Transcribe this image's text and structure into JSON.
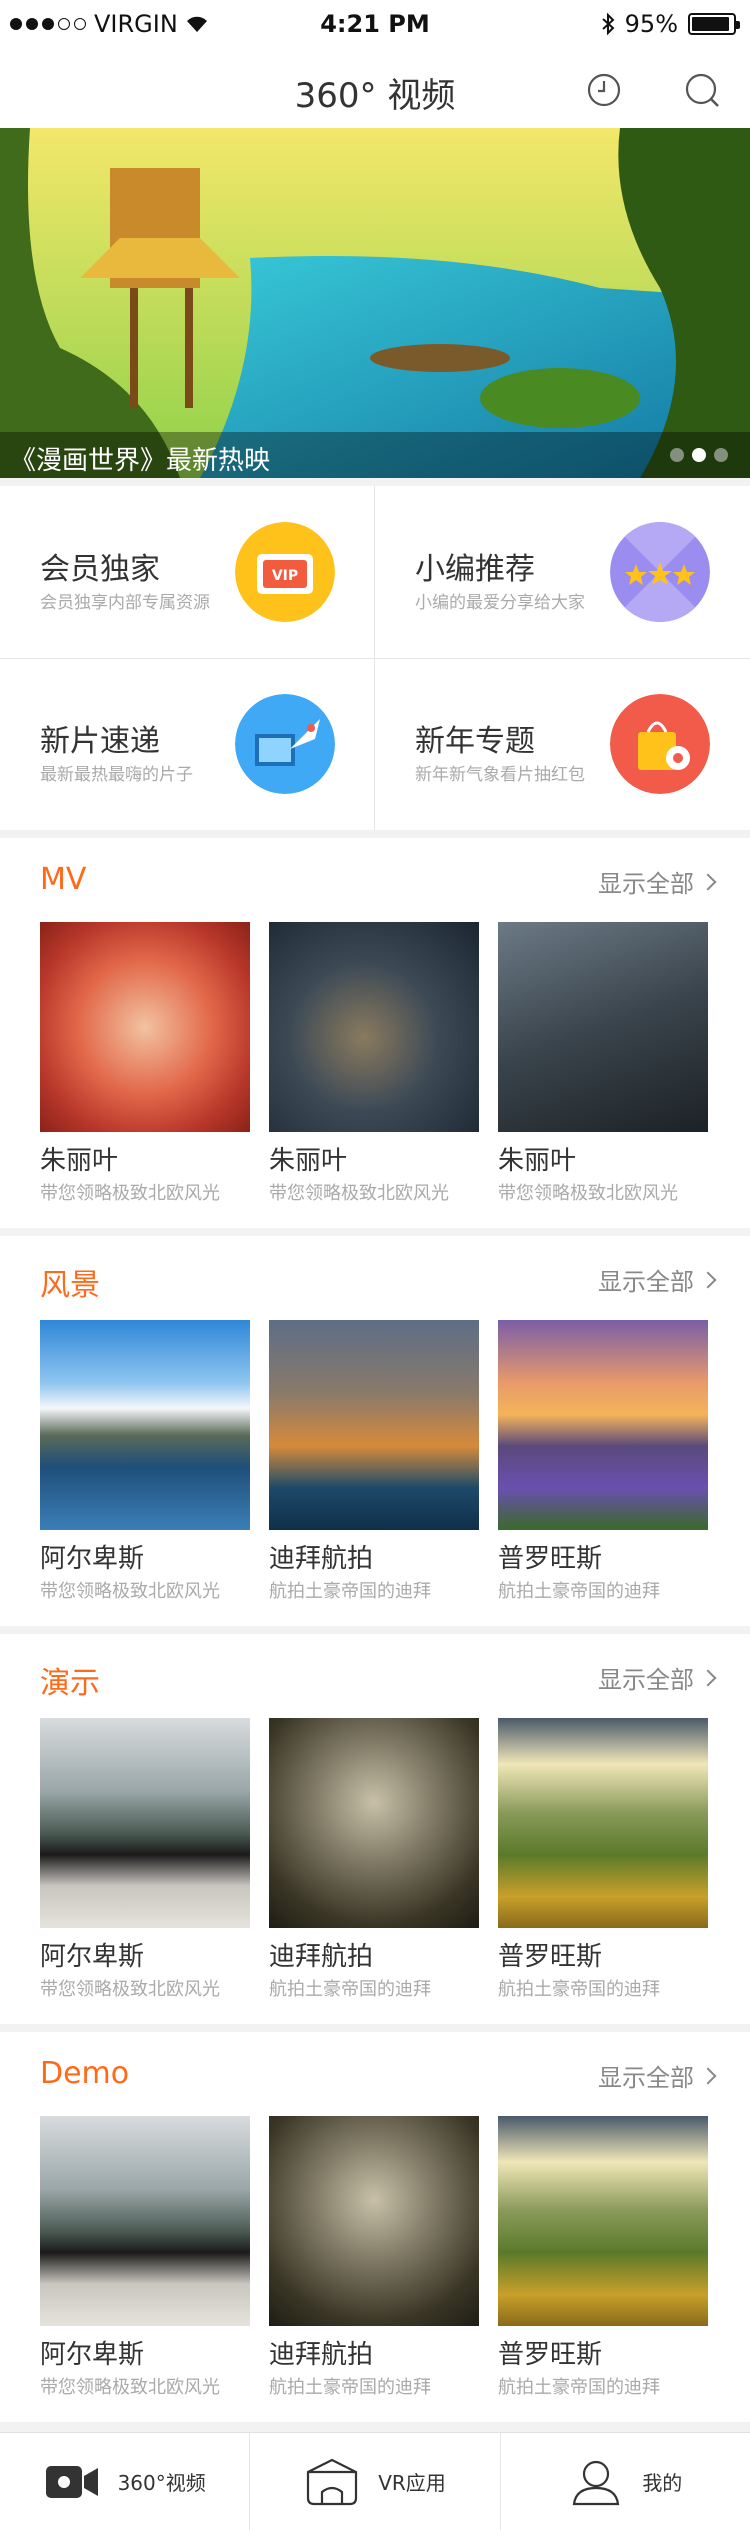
{
  "status": {
    "carrier": "VIRGIN",
    "time": "4:21 PM",
    "battery": "95%"
  },
  "nav": {
    "title": "360° 视频"
  },
  "banner": {
    "caption": "《漫画世界》最新热映"
  },
  "categories": [
    {
      "title": "会员独家",
      "sub": "会员独享内部专属资源",
      "badge_text": "VIP",
      "color": "#ffc21a"
    },
    {
      "title": "小编推荐",
      "sub": "小编的最爱分享给大家",
      "color": "#9b8cf0"
    },
    {
      "title": "新片速递",
      "sub": "最新最热最嗨的片子",
      "color": "#3fa9f5"
    },
    {
      "title": "新年专题",
      "sub": "新年新气象看片抽红包",
      "color": "#f25a4a"
    }
  ],
  "more_label": "显示全部",
  "sections": [
    {
      "title": "MV",
      "items": [
        {
          "title": "朱丽叶",
          "sub": "带您领略极致北欧风光"
        },
        {
          "title": "朱丽叶",
          "sub": "带您领略极致北欧风光"
        },
        {
          "title": "朱丽叶",
          "sub": "带您领略极致北欧风光"
        }
      ]
    },
    {
      "title": "风景",
      "items": [
        {
          "title": "阿尔卑斯",
          "sub": "带您领略极致北欧风光"
        },
        {
          "title": "迪拜航拍",
          "sub": "航拍土豪帝国的迪拜"
        },
        {
          "title": "普罗旺斯",
          "sub": "航拍土豪帝国的迪拜"
        }
      ]
    },
    {
      "title": "演示",
      "items": [
        {
          "title": "阿尔卑斯",
          "sub": "带您领略极致北欧风光"
        },
        {
          "title": "迪拜航拍",
          "sub": "航拍土豪帝国的迪拜"
        },
        {
          "title": "普罗旺斯",
          "sub": "航拍土豪帝国的迪拜"
        }
      ]
    },
    {
      "title": "Demo",
      "items": [
        {
          "title": "阿尔卑斯",
          "sub": "带您领略极致北欧风光"
        },
        {
          "title": "迪拜航拍",
          "sub": "航拍土豪帝国的迪拜"
        },
        {
          "title": "普罗旺斯",
          "sub": "航拍土豪帝国的迪拜"
        }
      ]
    }
  ],
  "tabs": [
    {
      "label": "360°视频",
      "icon": "video-camera-icon"
    },
    {
      "label": "VR应用",
      "icon": "vr-box-icon"
    },
    {
      "label": "我的",
      "icon": "user-icon"
    }
  ],
  "accent_color": "#ff6a1a"
}
